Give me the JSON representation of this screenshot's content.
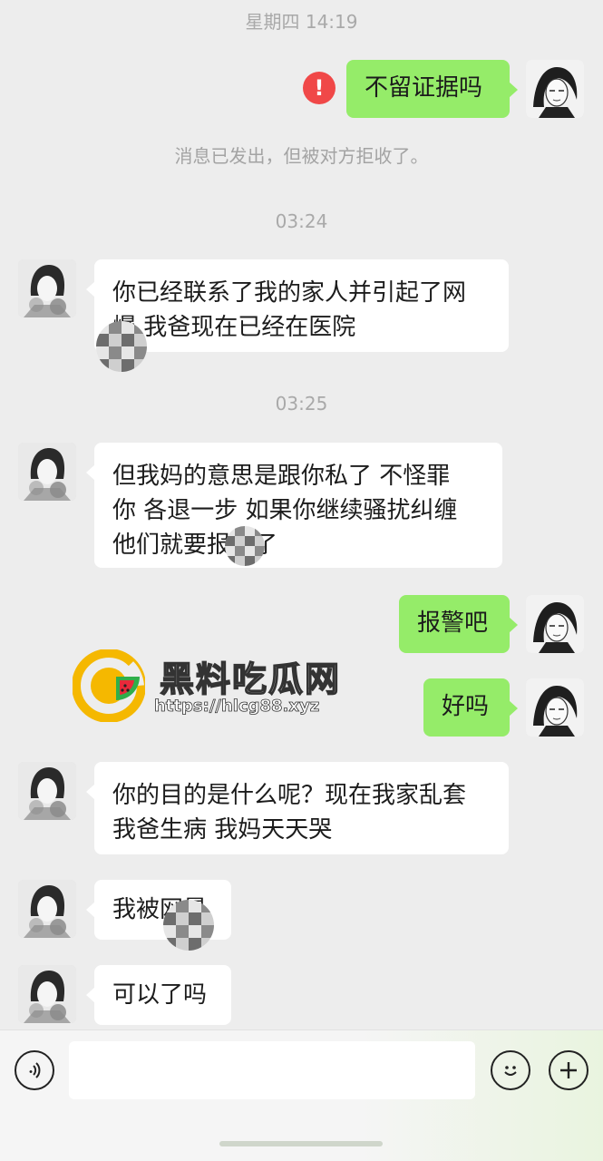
{
  "timestamps": {
    "t1": "星期四 14:19",
    "t2": "03:24",
    "t3": "03:25"
  },
  "system_note": "消息已发出，但被对方拒收了。",
  "messages": {
    "m1": {
      "direction": "out",
      "text": "不留证据吗"
    },
    "m2": {
      "direction": "in",
      "line1": "你已经联系了我的家人并引起了网",
      "line2": "爆 我爸现在已经在医院"
    },
    "m3": {
      "direction": "in",
      "line1": "但我妈的意思是跟你私了 不怪罪",
      "line2": "你 各退一步 如果你继续骚扰纠缠",
      "line3": "他们就要报警了"
    },
    "m4": {
      "direction": "out",
      "text": "报警吧"
    },
    "m5": {
      "direction": "out",
      "text": "好吗"
    },
    "m6": {
      "direction": "in",
      "line1": "你的目的是什么呢？现在我家乱套",
      "line2": "我爸生病 我妈天天哭"
    },
    "m7": {
      "direction": "in",
      "text": "我被网暴"
    },
    "m8": {
      "direction": "in",
      "text": "可以了吗"
    }
  },
  "error_icon": "!",
  "watermark": {
    "title": "黑料吃瓜网",
    "url": "https://hlcg88.xyz"
  },
  "icons": {
    "voice": "voice-icon",
    "emoji": "emoji-icon",
    "plus": "plus-icon",
    "error": "error-icon"
  },
  "colors": {
    "background": "#ededed",
    "bubble_out": "#95ec69",
    "bubble_in": "#ffffff",
    "error": "#f04848"
  }
}
